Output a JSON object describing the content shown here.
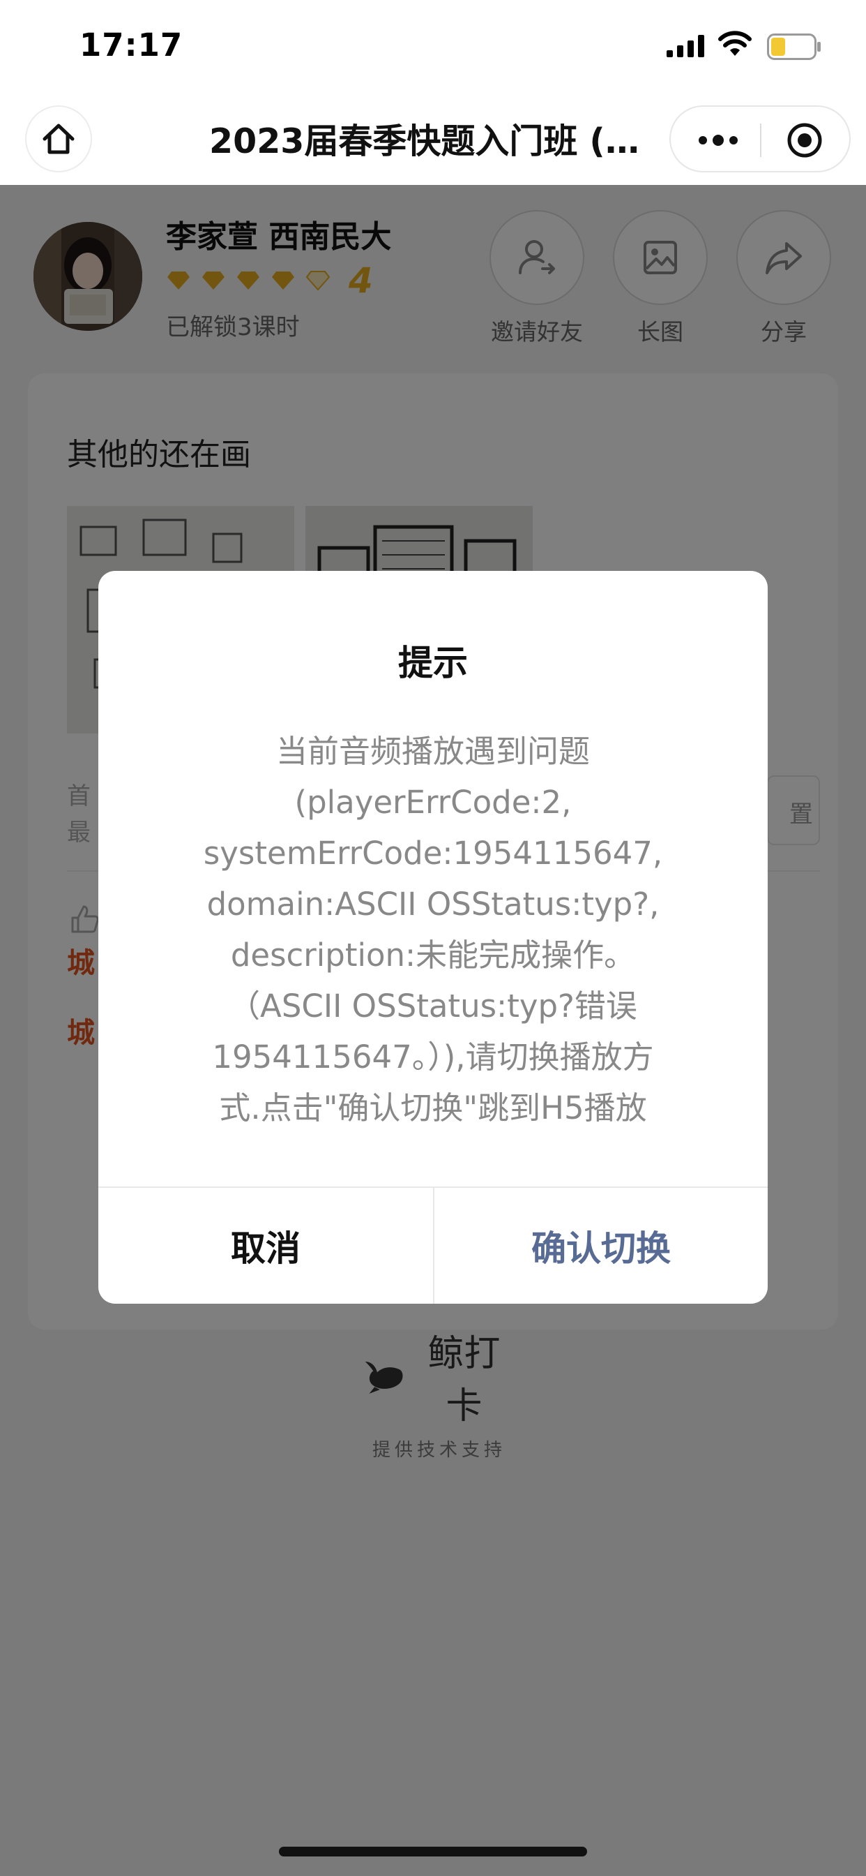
{
  "status_bar": {
    "time": "17:17"
  },
  "nav": {
    "title": "2023届春季快题入门班 (…"
  },
  "profile": {
    "name": "李家萱 西南民大",
    "level": "4",
    "unlock_text": "已解锁3课时",
    "rating_filled": 4,
    "rating_max": 5
  },
  "actions": [
    {
      "label": "邀请好友",
      "icon": "invite-icon"
    },
    {
      "label": "长图",
      "icon": "image-icon"
    },
    {
      "label": "分享",
      "icon": "share-icon"
    }
  ],
  "card": {
    "title": "其他的还在画",
    "first_line_1": "首",
    "first_line_2": "最",
    "right_button_text": "置",
    "city_1": "城",
    "city_2": "城"
  },
  "brand": {
    "name": "鲸打卡",
    "sub": "提供技术支持"
  },
  "modal": {
    "title": "提示",
    "lines": [
      "当前音频播放遇到问题",
      "(playerErrCode:2,",
      "systemErrCode:1954115647,",
      "domain:ASCII OSStatus:typ?,",
      "description:未能完成操作。",
      "（ASCII OSStatus:typ?错误",
      "1954115647。）),请切换播放方",
      "式.点击\"确认切换\"跳到H5播放"
    ],
    "cancel_label": "取消",
    "confirm_label": "确认切换"
  },
  "colors": {
    "accent_blue": "#576b95",
    "star_gold": "#e5ac1e",
    "city_red": "#e0531f",
    "mask": "rgba(0,0,0,0.5)"
  }
}
